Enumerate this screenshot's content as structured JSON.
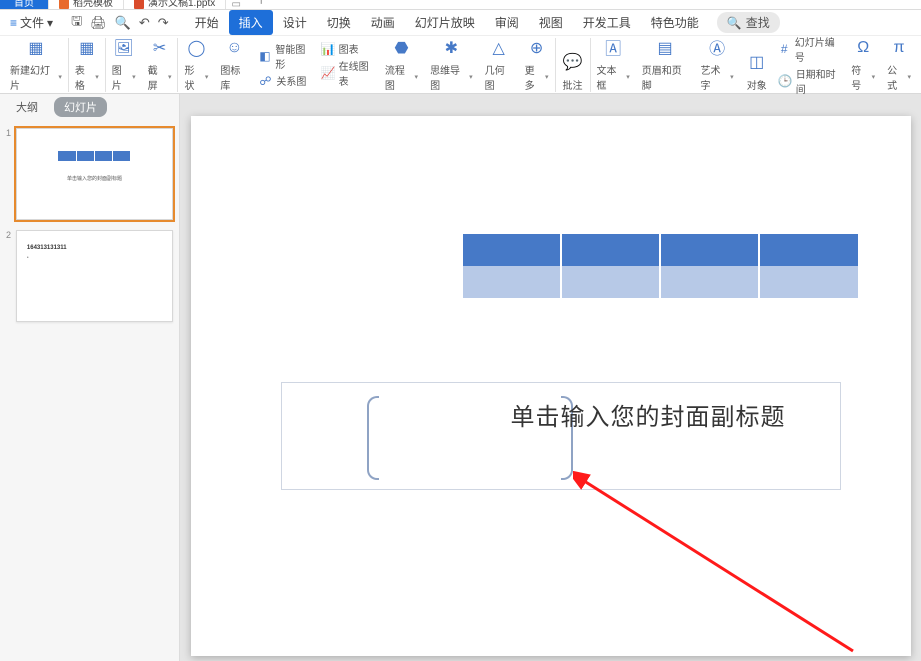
{
  "tabs": {
    "home": "首页",
    "doc1": "稻壳模板",
    "doc2": "演示文稿1.pptx"
  },
  "file_menu": {
    "label": "文件"
  },
  "menu_tabs": {
    "start": "开始",
    "insert": "插入",
    "design": "设计",
    "transition": "切换",
    "animation": "动画",
    "slideshow": "幻灯片放映",
    "review": "审阅",
    "view": "视图",
    "developer": "开发工具",
    "special": "特色功能",
    "search": "查找"
  },
  "ribbon": {
    "new_slide": "新建幻灯片",
    "table": "表格",
    "picture": "图片",
    "screenshot": "截屏",
    "shape": "形状",
    "icon_lib": "图标库",
    "smart_graphic": "智能图形",
    "chart": "图表",
    "relation": "关系图",
    "online_chart": "在线图表",
    "flowchart": "流程图",
    "mindmap": "思维导图",
    "geometry": "几何图",
    "more": "更多",
    "comment": "批注",
    "textbox": "文本框",
    "header_footer": "页眉和页脚",
    "wordart": "艺术字",
    "object": "对象",
    "slide_number": "幻灯片编号",
    "date_time": "日期和时间",
    "symbol": "符号",
    "equation": "公式"
  },
  "panel": {
    "outline": "大纲",
    "slides": "幻灯片"
  },
  "slide": {
    "subtitle_placeholder": "单击输入您的封面副标题"
  },
  "thumb1_caption": "单击输入您的封面副标题",
  "thumb2_line1": "164313131311",
  "thumb2_line2": "•"
}
